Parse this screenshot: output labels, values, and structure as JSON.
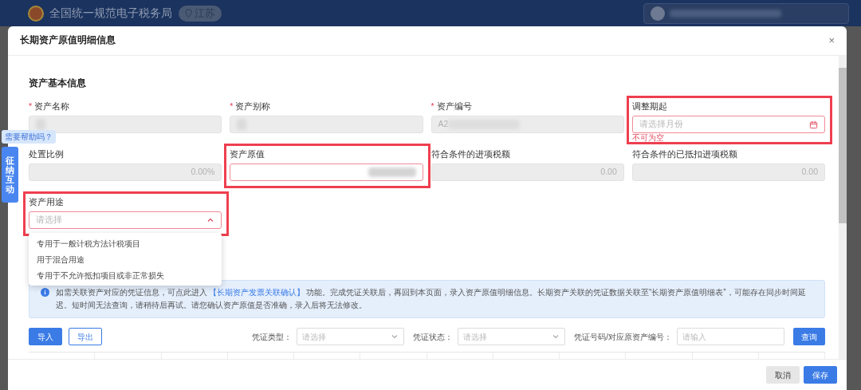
{
  "app_header": {
    "title": "全国统一规范电子税务局",
    "region": "江苏"
  },
  "dialog": {
    "title": "长期资产原值明细信息",
    "close": "×"
  },
  "section_title": "资产基本信息",
  "required_mark": "*",
  "fields": [
    {
      "label": "资产名称",
      "required": true,
      "kind": "text",
      "disabled": true,
      "blurred": true,
      "highlighted": false
    },
    {
      "label": "资产别称",
      "required": true,
      "kind": "text",
      "disabled": true,
      "blurred": true,
      "highlighted": false
    },
    {
      "label": "资产编号",
      "required": true,
      "kind": "text",
      "disabled": true,
      "value": "A2",
      "blurred": true,
      "highlighted": false
    },
    {
      "label": "调整期起",
      "required": false,
      "kind": "date",
      "disabled": false,
      "placeholder": "请选择月份",
      "error": "不可为空",
      "highlighted": true
    },
    {
      "label": "处置比例",
      "required": false,
      "kind": "number",
      "disabled": true,
      "value": "0.00%",
      "highlighted": false
    },
    {
      "label": "资产原值",
      "required": false,
      "kind": "number",
      "disabled": false,
      "blurred": true,
      "highlighted": true
    },
    {
      "label": "符合条件的进项税额",
      "required": false,
      "kind": "number",
      "disabled": true,
      "value": "0.00",
      "highlighted": false
    },
    {
      "label": "符合条件的已抵扣进项税额",
      "required": false,
      "kind": "number",
      "disabled": true,
      "value": "0.00",
      "highlighted": false
    },
    {
      "label": "资产用途",
      "required": false,
      "kind": "select",
      "disabled": false,
      "placeholder": "请选择",
      "highlighted": true,
      "expanded": true,
      "options": [
        "专用于一般计税方法计税项目",
        "用于混合用途",
        "专用于不允许抵扣项目或非正常损失"
      ]
    }
  ],
  "help": {
    "tooltip": "需要帮助吗？",
    "tab": "征纳互动"
  },
  "info": {
    "before": "如需关联资产对应的凭证信息，可点此进入",
    "link": "【长期资产发票关联确认】",
    "after": "功能。完成凭证关联后，再回到本页面，录入资产原值明细信息。长期资产关联的凭证数据关联至“长期资产原值明细表”，可能存在同步时间延迟。短时间无法查询，请稍待后再试。请您确认资产原值是否准确，录入后将无法修改。"
  },
  "toolbar": {
    "buttons": [
      {
        "label": "导入",
        "kind": "primary"
      },
      {
        "label": "导出",
        "kind": "outline"
      }
    ],
    "filters": [
      {
        "label": "凭证类型：",
        "kind": "select",
        "placeholder": "请选择"
      },
      {
        "label": "凭证状态：",
        "kind": "select",
        "placeholder": "请选择"
      },
      {
        "label": "凭证号码/对应原资产编号：",
        "kind": "input",
        "placeholder": "请输入"
      }
    ],
    "search": "查询"
  },
  "footer": {
    "buttons": [
      {
        "label": "取消",
        "kind": "secondary"
      },
      {
        "label": "保存",
        "kind": "primary"
      }
    ]
  }
}
